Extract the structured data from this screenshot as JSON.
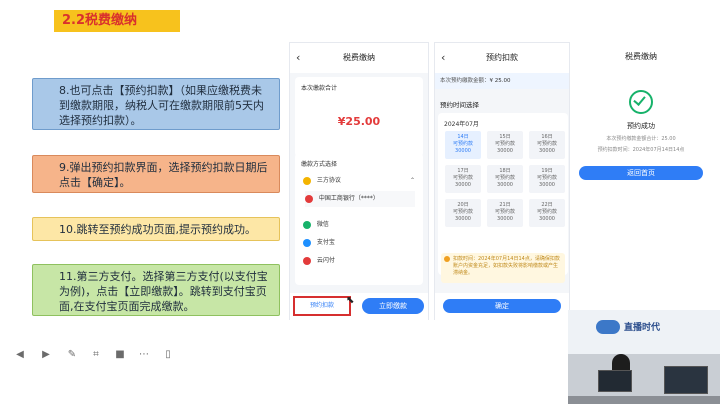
{
  "slide": {
    "title": "2.2税费缴纳",
    "notes": {
      "n8": "8.也可点击【预约扣款】（如果应缴税费未到缴款期限，纳税人可在缴款期限前5天内选择预约扣款）。",
      "n9": "9.弹出预约扣款界面，选择预约扣款日期后点击【确定】。",
      "n10": "10.跳转至预约成功页面,提示预约成功。",
      "n11": "11.第三方支付。选择第三方支付(以支付宝为例)，点击【立即缴款】。跳转到支付宝页面,在支付宝页面完成缴款。"
    }
  },
  "phone1": {
    "header": "税费缴纳",
    "total_label": "本次缴款合计",
    "amount": "¥25.00",
    "method_label": "缴款方式选择",
    "methods": [
      "三方协议",
      "中国工商银行（****）",
      "微信",
      "支付宝",
      "云闪付"
    ],
    "left_button": "预约扣款",
    "right_button": "立即缴款"
  },
  "phone2": {
    "header": "预约扣款",
    "summary": "本次预约缴款金额：",
    "summary_amount": "¥ 25.00",
    "section": "预约时间选择",
    "month": "2024年07月",
    "dates": [
      {
        "day": "14日",
        "label": "可预约款",
        "amount": "30000"
      },
      {
        "day": "15日",
        "label": "可预约款",
        "amount": "30000"
      },
      {
        "day": "16日",
        "label": "可预约款",
        "amount": "30000"
      },
      {
        "day": "17日",
        "label": "可预约款",
        "amount": "30000"
      },
      {
        "day": "18日",
        "label": "可预约款",
        "amount": "30000"
      },
      {
        "day": "19日",
        "label": "可预约款",
        "amount": "30000"
      },
      {
        "day": "20日",
        "label": "可预约款",
        "amount": "30000"
      },
      {
        "day": "21日",
        "label": "可预约款",
        "amount": "30000"
      },
      {
        "day": "22日",
        "label": "可预约款",
        "amount": "30000"
      }
    ],
    "warning": "扣款时间：2024年07月14日14点，请确保扣款账户内资金充足，如扣款失败将影响缴款或产生滞纳金。",
    "confirm": "确定"
  },
  "phone3": {
    "header": "税费缴纳",
    "success": "预约成功",
    "line1": "本次预约缴款金额合计：25.00",
    "line2": "预约扣款时间：2024年07月14日14点",
    "home_button": "返回首页"
  },
  "webcam": {
    "logo_text": "直播时代",
    "label": "直播时代"
  },
  "colors": {
    "accent": "#2f7df6",
    "title_bg": "#f7c21d",
    "title_text": "#d9312d",
    "success_green": "#17b26a"
  },
  "toolbar_icons": [
    "prev-icon",
    "next-icon",
    "pen-icon",
    "focus-icon",
    "camera-icon",
    "more-icon",
    "tablet-icon"
  ]
}
